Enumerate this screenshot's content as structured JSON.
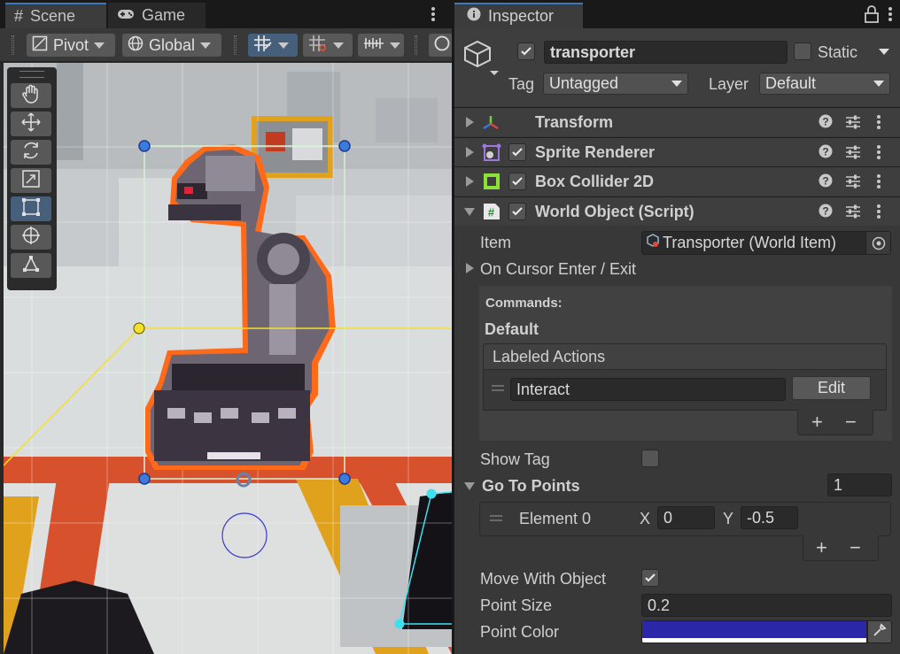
{
  "scene_tabs": {
    "scene": "Scene",
    "game": "Game"
  },
  "scene_toolbar": {
    "pivot": "Pivot",
    "global": "Global"
  },
  "inspector": {
    "tab": "Inspector",
    "object_name": "transporter",
    "static_label": "Static",
    "tag_label": "Tag",
    "tag_value": "Untagged",
    "layer_label": "Layer",
    "layer_value": "Default",
    "components": [
      {
        "name": "Transform"
      },
      {
        "name": "Sprite Renderer"
      },
      {
        "name": "Box Collider 2D"
      },
      {
        "name": "World Object (Script)"
      }
    ],
    "item_label": "Item",
    "item_value": "Transporter (World Item)",
    "on_cursor": "On Cursor Enter / Exit",
    "commands_label": "Commands:",
    "default_label": "Default",
    "labeled_actions": "Labeled Actions",
    "action_value": "Interact",
    "edit_button": "Edit",
    "plus": "+",
    "minus": "−",
    "show_tag": "Show Tag",
    "go_to_points": "Go To Points",
    "go_to_points_count": "1",
    "element_label": "Element 0",
    "x_label": "X",
    "x_value": "0",
    "y_label": "Y",
    "y_value": "-0.5",
    "move_with_object": "Move With Object",
    "point_size_label": "Point Size",
    "point_size_value": "0.2",
    "point_color_label": "Point Color",
    "point_color": "#2a28a8"
  }
}
